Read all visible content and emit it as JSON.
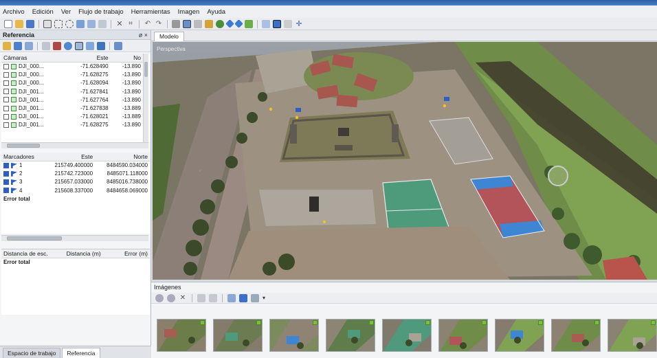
{
  "menu": [
    "Archivo",
    "Edición",
    "Ver",
    "Flujo de trabajo",
    "Herramientas",
    "Imagen",
    "Ayuda"
  ],
  "reference_panel": {
    "title": "Referencia",
    "controls": "ø ×",
    "cameras": {
      "headers": [
        "Cámaras",
        "Este",
        "No"
      ],
      "rows": [
        {
          "name": "DJI_000...",
          "este": "-71.628490",
          "norte": "-13.890"
        },
        {
          "name": "DJI_000...",
          "este": "-71.628275",
          "norte": "-13.890"
        },
        {
          "name": "DJI_000...",
          "este": "-71.628094",
          "norte": "-13.890"
        },
        {
          "name": "DJI_001...",
          "este": "-71.627841",
          "norte": "-13.890"
        },
        {
          "name": "DJI_001...",
          "este": "-71.627764",
          "norte": "-13.890"
        },
        {
          "name": "DJI_001...",
          "este": "-71.627838",
          "norte": "-13.889"
        },
        {
          "name": "DJI_001...",
          "este": "-71.628021",
          "norte": "-13.889"
        },
        {
          "name": "DJI_001...",
          "este": "-71.628275",
          "norte": "-13.890"
        }
      ]
    },
    "markers": {
      "headers": [
        "Marcadores",
        "Este",
        "Norte"
      ],
      "rows": [
        {
          "name": "1",
          "este": "215749.400000",
          "norte": "8484590.034000"
        },
        {
          "name": "2",
          "este": "215742.723000",
          "norte": "8485071.118000"
        },
        {
          "name": "3",
          "este": "215657.033000",
          "norte": "8485016.738000"
        },
        {
          "name": "4",
          "este": "215608.337000",
          "norte": "8484658.069000"
        }
      ],
      "total_label": "Error total"
    },
    "scalebars": {
      "headers": [
        "Distancia de esc.",
        "Distancia (m)",
        "Error (m)"
      ],
      "total_label": "Error total"
    }
  },
  "bottom_tabs": [
    "Espacio de trabajo",
    "Referencia"
  ],
  "model": {
    "tab_label": "Modelo",
    "view_label": "Perspectiva"
  },
  "images_panel": {
    "title": "Imágenes",
    "thumbnail_count": 9
  },
  "colors": {
    "accent": "#2d5ec4",
    "thumb_badge": "#7bc043"
  }
}
